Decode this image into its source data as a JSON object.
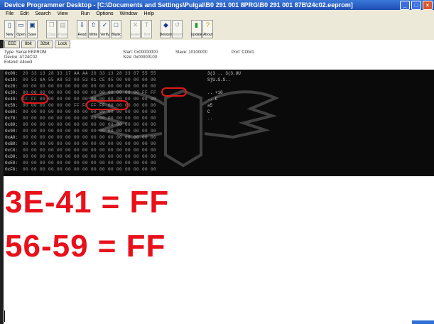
{
  "window": {
    "title": "Device Programmer Desktop - [C:\\Documents and Settings\\Pulgal\\B0 291 001 8PRG\\B0 291 001 87B\\24c02.eeprom]",
    "controls": [
      "minimize",
      "maximize",
      "close"
    ]
  },
  "menu": [
    {
      "label": "File",
      "enabled": true
    },
    {
      "label": "Edit",
      "enabled": true
    },
    {
      "label": "Search",
      "enabled": true
    },
    {
      "label": "View",
      "enabled": true
    },
    {
      "label": "",
      "enabled": false
    },
    {
      "label": "Run",
      "enabled": true
    },
    {
      "label": "Options",
      "enabled": true
    },
    {
      "label": "Window",
      "enabled": true
    },
    {
      "label": "Help",
      "enabled": true
    }
  ],
  "toolbar": [
    {
      "label": "New",
      "icon": "new-file-icon",
      "enabled": true
    },
    {
      "label": "Open",
      "icon": "open-folder-icon",
      "enabled": true
    },
    {
      "label": "Save",
      "icon": "save-icon",
      "enabled": true
    },
    {
      "label": "Copy",
      "icon": "copy-icon",
      "enabled": false
    },
    {
      "label": "Paste",
      "icon": "paste-icon",
      "enabled": false
    },
    {
      "label": "Read",
      "icon": "read-icon",
      "enabled": true
    },
    {
      "label": "Write",
      "icon": "write-icon",
      "enabled": true
    },
    {
      "label": "Verify",
      "icon": "verify-icon",
      "enabled": true
    },
    {
      "label": "Blank",
      "icon": "blank-icon",
      "enabled": true
    },
    {
      "label": "Erase",
      "icon": "erase-icon",
      "enabled": false
    },
    {
      "label": "Test",
      "icon": "test-icon",
      "enabled": false
    },
    {
      "label": "Devices",
      "icon": "devices-icon",
      "enabled": true
    },
    {
      "label": "Restore",
      "icon": "restore-icon",
      "enabled": false
    },
    {
      "label": "Update",
      "icon": "update-icon",
      "enabled": true
    },
    {
      "label": "About",
      "icon": "about-icon",
      "enabled": true
    }
  ],
  "tabs": [
    "EEE",
    "8bit",
    "32bit",
    "Lock"
  ],
  "info": {
    "type": "Type: Serial EEPROM",
    "device": "Device: AT24C02",
    "extra": "Extend: Allow3",
    "start": "Start: 0x00000000",
    "size": "Size: 0x00000100",
    "slave": "Slave: 10100000",
    "port": "Port: COM1"
  },
  "hex_rows": [
    {
      "addr": "0x00:",
      "bytes": "20 33 13 28 33 17 AA AA 20 33 13 28 33 07 55 55",
      "ascii": "3(3 .. 3(3.UU"
    },
    {
      "addr": "0x10:",
      "bytes": "00 53 6A 55 A8 53 00 53 01 CE 95 00 00 00 00 00",
      "ascii": "SjU.S.S.."
    },
    {
      "addr": "0x20:",
      "bytes": "00 00 00 00 00 00 00 00 00 00 00 00 00 00 00 00",
      "ascii": ""
    },
    {
      "addr": "0x30:",
      "bytes": "00 00 00 00 00 00 00 00 00 00 00 00 00 00 FF FF",
      "ascii": ".. +10"
    },
    {
      "addr": "0x40:",
      "bytes": "FF FF 00 00 00 00 00 00 00 00 00 00 00 00 00 00",
      "ascii": ".. C"
    },
    {
      "addr": "0x50:",
      "bytes": "00 00 00 00 00 00 FF FF FF FF 00 00 00 00 00 00",
      "ascii": "a5"
    },
    {
      "addr": "0x60:",
      "bytes": "00 00 00 00 00 00 00 00 00 00 00 00 00 00 00 00",
      "ascii": "C"
    },
    {
      "addr": "0x70:",
      "bytes": "00 00 00 00 00 00 00 00 00 00 00 00 00 00 00 00",
      "ascii": ".."
    },
    {
      "addr": "0x80:",
      "bytes": "00 00 00 00 00 00 00 00 00 00 00 00 00 00 00 00",
      "ascii": ""
    },
    {
      "addr": "0x90:",
      "bytes": "00 00 00 00 00 00 00 00 00 00 00 00 00 00 00 00",
      "ascii": ""
    },
    {
      "addr": "0xA0:",
      "bytes": "00 00 00 00 00 00 00 00 00 00 00 00 00 00 00 00",
      "ascii": ""
    },
    {
      "addr": "0xB0:",
      "bytes": "00 00 00 00 00 00 00 00 00 00 00 00 00 00 00 00",
      "ascii": ""
    },
    {
      "addr": "0xC0:",
      "bytes": "00 00 00 00 00 00 00 00 00 00 00 00 00 00 00 00",
      "ascii": ""
    },
    {
      "addr": "0xD0:",
      "bytes": "00 00 00 00 00 00 00 00 00 00 00 00 00 00 00 00",
      "ascii": ""
    },
    {
      "addr": "0xE0:",
      "bytes": "00 00 00 00 00 00 00 00 00 00 00 00 00 00 00 00",
      "ascii": ""
    },
    {
      "addr": "0xF0:",
      "bytes": "00 00 00 00 00 00 00 00 00 00 00 00 00 00 00 00",
      "ascii": ""
    }
  ],
  "annotations": {
    "line1": "3E-41 = FF",
    "line2": "56-59 = FF"
  },
  "colors": {
    "annotation_red": "#e8101a",
    "highlight_red": "#e01818",
    "hex_background": "#0a0a0a",
    "titlebar_blue": "#1f4fb4"
  }
}
